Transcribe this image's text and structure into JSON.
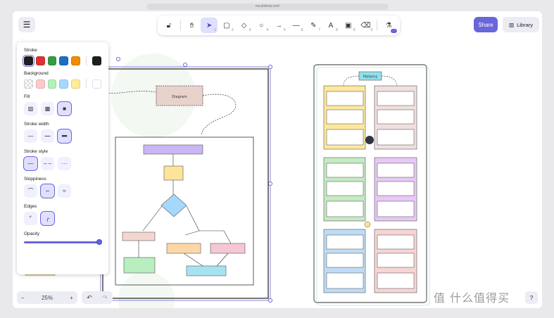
{
  "browser": {
    "url": "excalidraw.com"
  },
  "toolbar": {
    "tools": [
      {
        "name": "lock",
        "icon": "lock-icon",
        "key": ""
      },
      {
        "name": "hand",
        "icon": "hand-icon",
        "key": ""
      },
      {
        "name": "selection",
        "icon": "cursor-icon",
        "key": "1"
      },
      {
        "name": "rectangle",
        "icon": "square-icon",
        "key": "2"
      },
      {
        "name": "diamond",
        "icon": "diamond-icon",
        "key": "3"
      },
      {
        "name": "ellipse",
        "icon": "circle-icon",
        "key": "4"
      },
      {
        "name": "arrow",
        "icon": "arrow-icon",
        "key": "5"
      },
      {
        "name": "line",
        "icon": "line-icon",
        "key": "6"
      },
      {
        "name": "draw",
        "icon": "pencil-icon",
        "key": "7"
      },
      {
        "name": "text",
        "icon": "text-icon",
        "key": "8"
      },
      {
        "name": "image",
        "icon": "image-icon",
        "key": "9"
      },
      {
        "name": "eraser",
        "icon": "eraser-icon",
        "key": "0"
      },
      {
        "name": "library-tool",
        "icon": "shapes-icon",
        "key": ""
      }
    ],
    "active_tool": "selection"
  },
  "header": {
    "share_label": "Share",
    "library_label": "Library"
  },
  "properties": {
    "stroke_label": "Stroke",
    "stroke_colors": [
      "#1e1e1e",
      "#e03131",
      "#2f9e44",
      "#1971c2",
      "#f08c00"
    ],
    "stroke_current": "#1e1e1e",
    "background_label": "Background",
    "background_colors": [
      "transparent",
      "#ffc9c9",
      "#b2f2bb",
      "#a5d8ff",
      "#ffec99"
    ],
    "background_current": "#ffffff",
    "fill_label": "Fill",
    "stroke_width_label": "Stroke width",
    "stroke_style_label": "Stroke style",
    "sloppiness_label": "Sloppiness",
    "edges_label": "Edges",
    "opacity_label": "Opacity",
    "opacity_value": 100
  },
  "footer": {
    "zoom": "25%",
    "zoom_out": "−",
    "zoom_in": "+"
  },
  "canvas": {
    "diagram_title": "Diagram",
    "patterns_title": "Patterns"
  },
  "watermark": "值 什么值得买"
}
